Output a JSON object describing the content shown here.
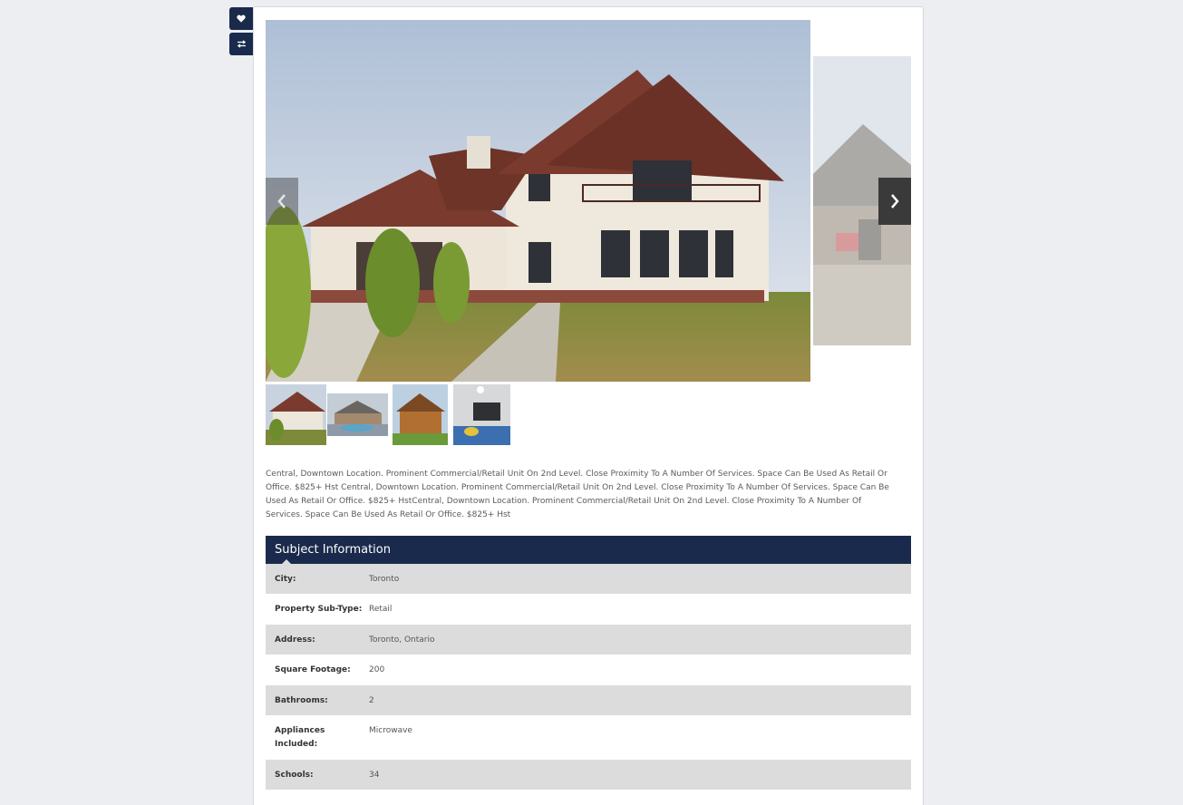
{
  "actions": {
    "favorite_icon": "heart-icon",
    "compare_icon": "swap-icon"
  },
  "gallery": {
    "prev_icon": "chevron-left-icon",
    "next_icon": "chevron-right-icon"
  },
  "description": "Central, Downtown Location. Prominent Commercial/Retail Unit On 2nd Level. Close Proximity To A Number Of Services. Space Can Be Used As Retail Or Office. $825+ Hst Central, Downtown Location. Prominent Commercial/Retail Unit On 2nd Level. Close Proximity To A Number Of Services. Space Can Be Used As Retail Or Office. $825+ HstCentral, Downtown Location. Prominent Commercial/Retail Unit On 2nd Level. Close Proximity To A Number Of Services. Space Can Be Used As Retail Or Office. $825+ Hst",
  "subject": {
    "title": "Subject Information",
    "rows": [
      {
        "label": "City:",
        "value": "Toronto"
      },
      {
        "label": "Property Sub-Type:",
        "value": "Retail"
      },
      {
        "label": "Address:",
        "value": "Toronto, Ontario"
      },
      {
        "label": "Square Footage:",
        "value": "200"
      },
      {
        "label": "Bathrooms:",
        "value": "2"
      },
      {
        "label": "Appliances Included:",
        "value": "Microwave"
      },
      {
        "label": "Schools:",
        "value": "34"
      }
    ]
  },
  "colors": {
    "header_bg": "#1a2a4c",
    "row_shade": "#dcdcdc"
  }
}
